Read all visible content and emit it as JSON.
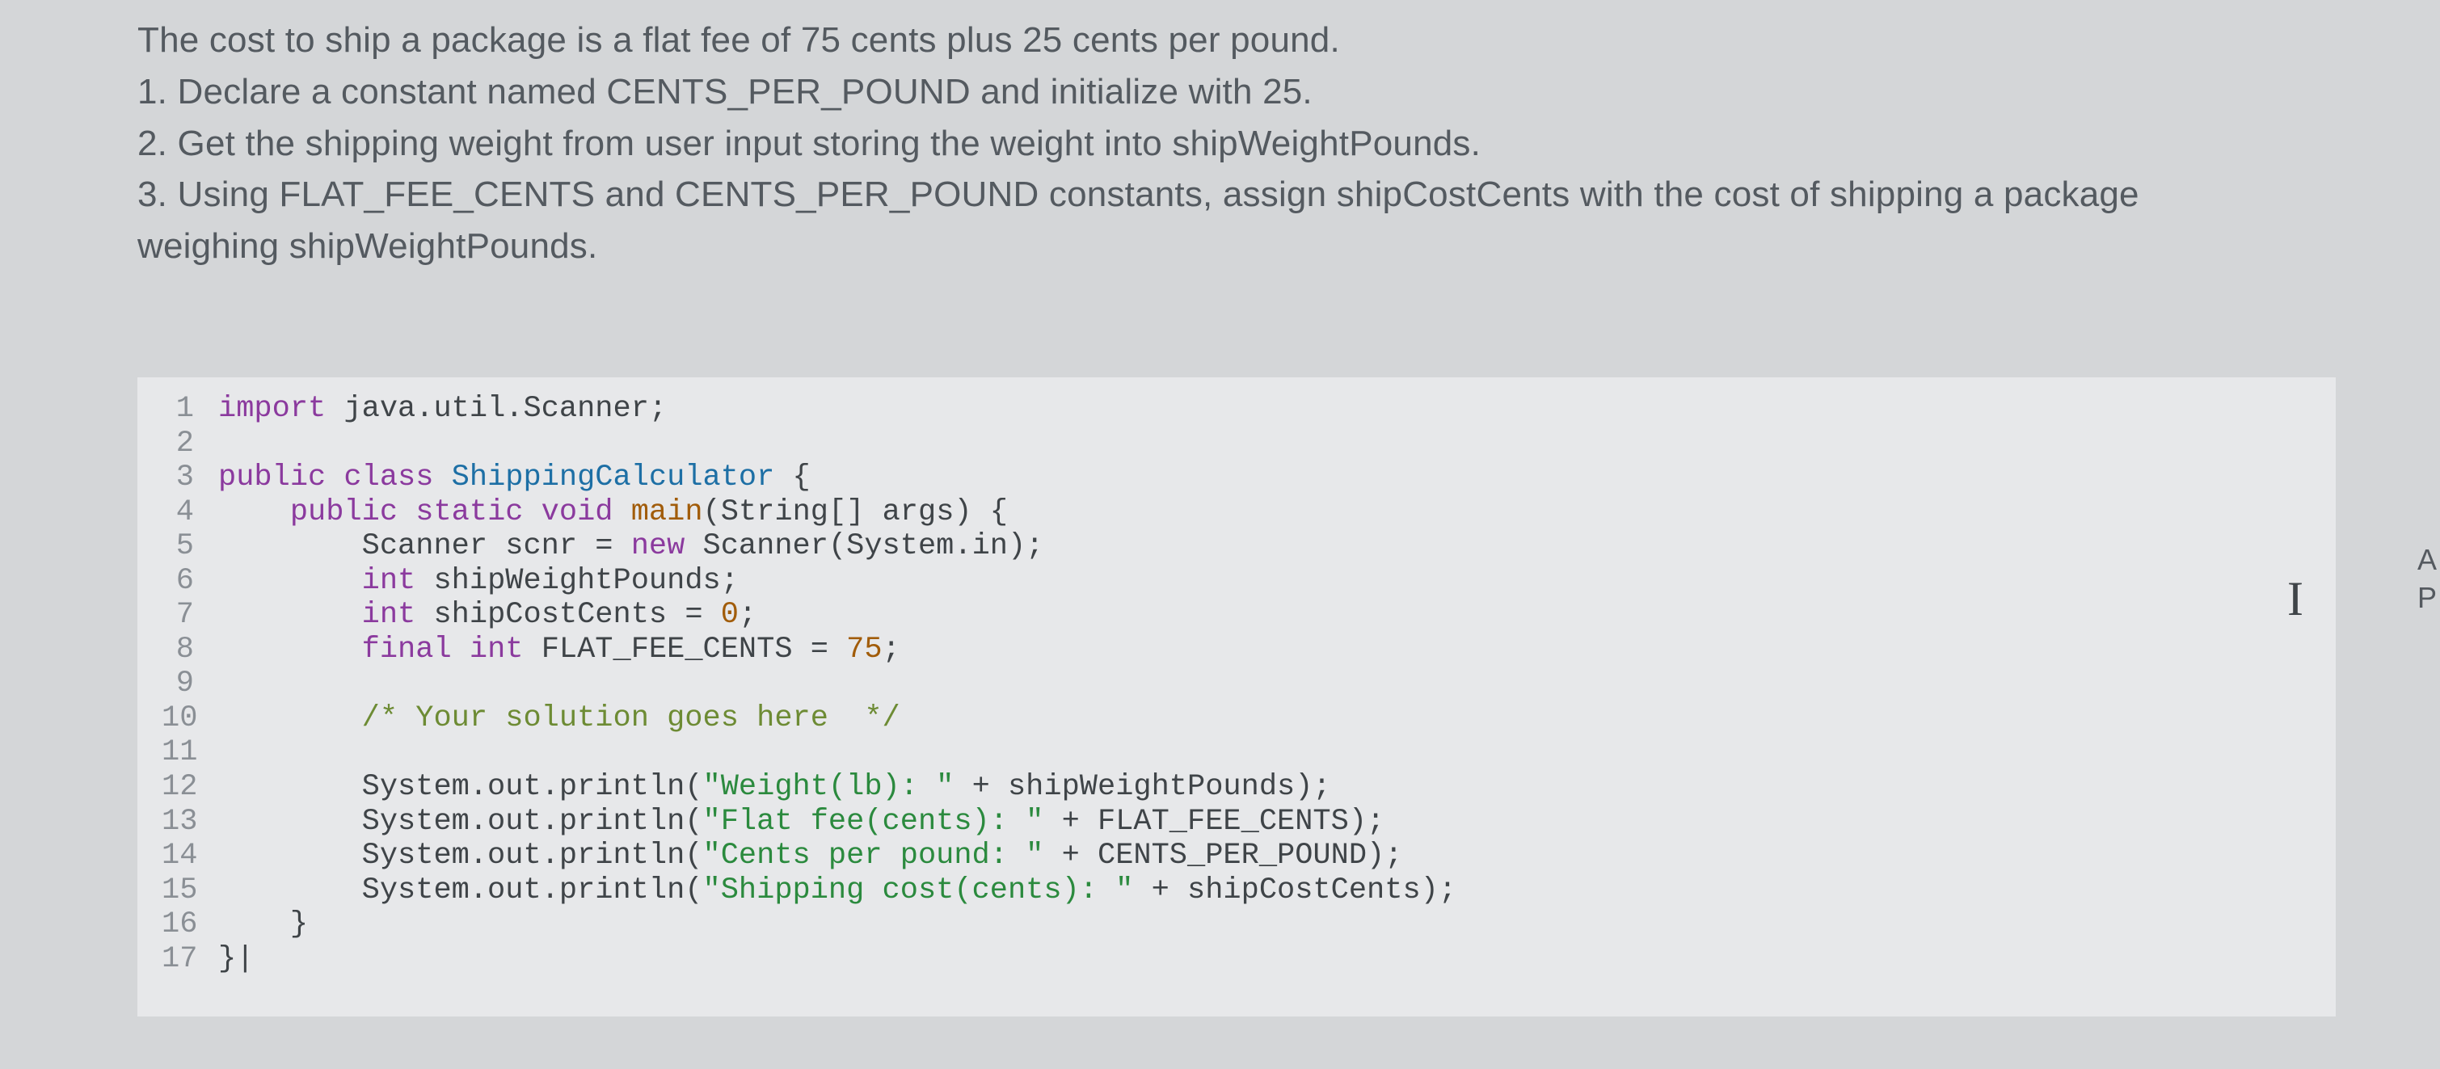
{
  "instructions": {
    "line1": "The cost to ship a package is a flat fee of 75 cents plus 25 cents per pound.",
    "line2": "1. Declare a constant named CENTS_PER_POUND and initialize with 25.",
    "line3": "2. Get the shipping weight from user input storing the weight into shipWeightPounds.",
    "line4": "3. Using FLAT_FEE_CENTS and CENTS_PER_POUND constants, assign shipCostCents with the cost of shipping a package weighing shipWeightPounds."
  },
  "code": {
    "lines": [
      {
        "n": "1",
        "tokens": [
          {
            "c": "kw",
            "t": "import"
          },
          {
            "c": "",
            "t": " java.util.Scanner;"
          }
        ]
      },
      {
        "n": "2",
        "tokens": []
      },
      {
        "n": "3",
        "tokens": [
          {
            "c": "kw",
            "t": "public class"
          },
          {
            "c": "",
            "t": " "
          },
          {
            "c": "cls",
            "t": "ShippingCalculator"
          },
          {
            "c": "",
            "t": " {"
          }
        ]
      },
      {
        "n": "4",
        "tokens": [
          {
            "c": "",
            "t": "    "
          },
          {
            "c": "kw",
            "t": "public static void"
          },
          {
            "c": "",
            "t": " "
          },
          {
            "c": "fn",
            "t": "main"
          },
          {
            "c": "",
            "t": "(String[] args) {"
          }
        ]
      },
      {
        "n": "5",
        "tokens": [
          {
            "c": "",
            "t": "        Scanner scnr = "
          },
          {
            "c": "kw",
            "t": "new"
          },
          {
            "c": "",
            "t": " Scanner(System.in);"
          }
        ]
      },
      {
        "n": "6",
        "tokens": [
          {
            "c": "",
            "t": "        "
          },
          {
            "c": "kw",
            "t": "int"
          },
          {
            "c": "",
            "t": " shipWeightPounds;"
          }
        ]
      },
      {
        "n": "7",
        "tokens": [
          {
            "c": "",
            "t": "        "
          },
          {
            "c": "kw",
            "t": "int"
          },
          {
            "c": "",
            "t": " shipCostCents = "
          },
          {
            "c": "num",
            "t": "0"
          },
          {
            "c": "",
            "t": ";"
          }
        ]
      },
      {
        "n": "8",
        "tokens": [
          {
            "c": "",
            "t": "        "
          },
          {
            "c": "kw",
            "t": "final int"
          },
          {
            "c": "",
            "t": " FLAT_FEE_CENTS = "
          },
          {
            "c": "num",
            "t": "75"
          },
          {
            "c": "",
            "t": ";"
          }
        ]
      },
      {
        "n": "9",
        "tokens": []
      },
      {
        "n": "10",
        "tokens": [
          {
            "c": "",
            "t": "        "
          },
          {
            "c": "cmt",
            "t": "/* Your solution goes here  */"
          }
        ]
      },
      {
        "n": "11",
        "tokens": []
      },
      {
        "n": "12",
        "tokens": [
          {
            "c": "",
            "t": "        System.out.println("
          },
          {
            "c": "str",
            "t": "\"Weight(lb): \""
          },
          {
            "c": "",
            "t": " + shipWeightPounds);"
          }
        ]
      },
      {
        "n": "13",
        "tokens": [
          {
            "c": "",
            "t": "        System.out.println("
          },
          {
            "c": "str",
            "t": "\"Flat fee(cents): \""
          },
          {
            "c": "",
            "t": " + FLAT_FEE_CENTS);"
          }
        ]
      },
      {
        "n": "14",
        "tokens": [
          {
            "c": "",
            "t": "        System.out.println("
          },
          {
            "c": "str",
            "t": "\"Cents per pound: \""
          },
          {
            "c": "",
            "t": " + CENTS_PER_POUND);"
          }
        ]
      },
      {
        "n": "15",
        "tokens": [
          {
            "c": "",
            "t": "        System.out.println("
          },
          {
            "c": "str",
            "t": "\"Shipping cost(cents): \""
          },
          {
            "c": "",
            "t": " + shipCostCents);"
          }
        ]
      },
      {
        "n": "16",
        "tokens": [
          {
            "c": "",
            "t": "    }"
          }
        ]
      },
      {
        "n": "17",
        "tokens": [
          {
            "c": "",
            "t": "}"
          }
        ]
      }
    ]
  },
  "cursor": "I",
  "side": {
    "a": "A",
    "p": "P"
  }
}
